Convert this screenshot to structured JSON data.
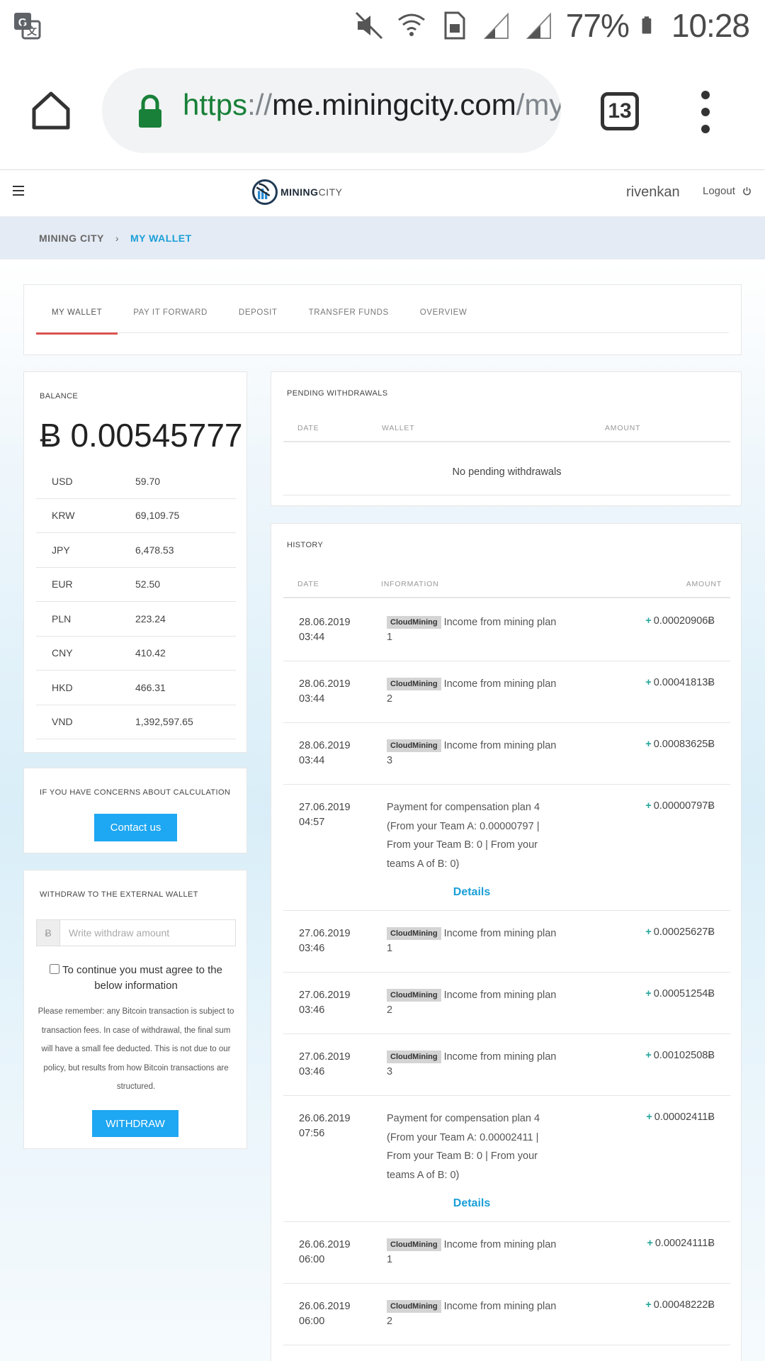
{
  "status_bar": {
    "battery": "77%",
    "time": "10:28"
  },
  "browser": {
    "url_scheme": "https",
    "url_sep": "://",
    "url_host": "me.miningcity.com",
    "url_path": "/my",
    "tab_count": "13"
  },
  "header": {
    "logo_main": "MINING",
    "logo_city": "CITY",
    "username": "rivenkan",
    "logout": "Logout"
  },
  "breadcrumb": {
    "home": "MINING CITY",
    "separator": "›",
    "current": "MY WALLET"
  },
  "tabs": [
    "MY WALLET",
    "PAY IT FORWARD",
    "DEPOSIT",
    "TRANSFER FUNDS",
    "OVERVIEW"
  ],
  "balance": {
    "title": "BALANCE",
    "amount": "Ƀ 0.00545777",
    "rates": [
      {
        "currency": "USD",
        "value": "59.70"
      },
      {
        "currency": "KRW",
        "value": "69,109.75"
      },
      {
        "currency": "JPY",
        "value": "6,478.53"
      },
      {
        "currency": "EUR",
        "value": "52.50"
      },
      {
        "currency": "PLN",
        "value": "223.24"
      },
      {
        "currency": "CNY",
        "value": "410.42"
      },
      {
        "currency": "HKD",
        "value": "466.31"
      },
      {
        "currency": "VND",
        "value": "1,392,597.65"
      }
    ]
  },
  "concerns": {
    "title": "IF YOU HAVE CONCERNS ABOUT CALCULATION",
    "button": "Contact us"
  },
  "withdraw": {
    "title": "WITHDRAW TO THE EXTERNAL WALLET",
    "currency_symbol": "Ƀ",
    "placeholder": "Write withdraw amount",
    "agree": "To continue you must agree to the below information",
    "notice": "Please remember: any Bitcoin transaction is subject to transaction fees. In case of withdrawal, the final sum will have a small fee deducted. This is not due to our policy, but results from how Bitcoin transactions are structured.",
    "button": "WITHDRAW"
  },
  "pending": {
    "title": "PENDING WITHDRAWALS",
    "columns": [
      "DATE",
      "WALLET",
      "AMOUNT"
    ],
    "empty": "No pending withdrawals"
  },
  "history": {
    "title": "HISTORY",
    "columns": [
      "DATE",
      "INFORMATION",
      "AMOUNT"
    ],
    "tag": "CloudMining",
    "details_label": "Details",
    "rows": [
      {
        "date": "28.06.2019",
        "time": "03:44",
        "info": "Income from mining plan 1",
        "amount": "0.00020906Ƀ"
      },
      {
        "date": "28.06.2019",
        "time": "03:44",
        "info": "Income from mining plan 2",
        "amount": "0.00041813Ƀ"
      },
      {
        "date": "28.06.2019",
        "time": "03:44",
        "info": "Income from mining plan 3",
        "amount": "0.00083625Ƀ"
      },
      {
        "date": "27.06.2019",
        "time": "04:57",
        "info": "Payment for compensation plan 4 (From your Team A: 0.00000797 | From your Team B: 0 | From your teams A of B: 0)",
        "amount": "0.00000797Ƀ"
      },
      {
        "date": "27.06.2019",
        "time": "03:46",
        "info": "Income from mining plan 1",
        "amount": "0.00025627Ƀ"
      },
      {
        "date": "27.06.2019",
        "time": "03:46",
        "info": "Income from mining plan 2",
        "amount": "0.00051254Ƀ"
      },
      {
        "date": "27.06.2019",
        "time": "03:46",
        "info": "Income from mining plan 3",
        "amount": "0.00102508Ƀ"
      },
      {
        "date": "26.06.2019",
        "time": "07:56",
        "info": "Payment for compensation plan 4 (From your Team A: 0.00002411 | From your Team B: 0 | From your teams A of B: 0)",
        "amount": "0.00002411Ƀ"
      },
      {
        "date": "26.06.2019",
        "time": "06:00",
        "info": "Income from mining plan 1",
        "amount": "0.00024111Ƀ"
      },
      {
        "date": "26.06.2019",
        "time": "06:00",
        "info": "Income from mining plan 2",
        "amount": "0.00048222Ƀ"
      }
    ]
  }
}
